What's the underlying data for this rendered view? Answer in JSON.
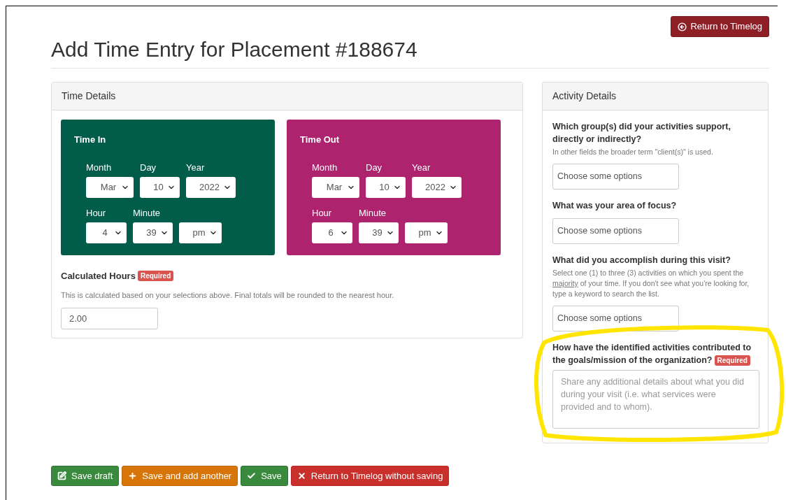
{
  "page": {
    "title": "Add Time Entry for Placement #188674",
    "return_button": "Return to Timelog"
  },
  "time_details": {
    "heading": "Time Details",
    "blocks": [
      {
        "title": "Time In",
        "color": "#025c4a",
        "date_fields": [
          {
            "label": "Month",
            "value": "Mar"
          },
          {
            "label": "Day",
            "value": "10"
          },
          {
            "label": "Year",
            "value": "2022"
          }
        ],
        "time_fields": [
          {
            "label": "Hour",
            "value": "4"
          },
          {
            "label": "Minute",
            "value": "39"
          },
          {
            "value": "pm"
          }
        ]
      },
      {
        "title": "Time Out",
        "color": "#ad236e",
        "date_fields": [
          {
            "label": "Month",
            "value": "Mar"
          },
          {
            "label": "Day",
            "value": "10"
          },
          {
            "label": "Year",
            "value": "2022"
          }
        ],
        "time_fields": [
          {
            "label": "Hour",
            "value": "6"
          },
          {
            "label": "Minute",
            "value": "39"
          },
          {
            "value": "pm"
          }
        ]
      }
    ],
    "calculated": {
      "label": "Calculated Hours",
      "badge": "Required",
      "help": "This is calculated based on your selections above. Final totals will be rounded to the nearest hour.",
      "value": "2.00"
    }
  },
  "activity_details": {
    "heading": "Activity Details",
    "questions": [
      {
        "kind": "select",
        "label": "Which group(s) did your activities support, directly or indirectly?",
        "help": [
          {
            "kind": "text",
            "text": "In other fields the broader term \"client(s)\" is used."
          }
        ],
        "placeholder": "Choose some options"
      },
      {
        "kind": "select",
        "label": "What was your area of focus?",
        "placeholder": "Choose some options"
      },
      {
        "kind": "select",
        "label": "What did you accomplish during this visit?",
        "help": [
          {
            "kind": "text",
            "text": "Select one (1) to three (3) activities on which you spent the "
          },
          {
            "kind": "link",
            "text": "majority"
          },
          {
            "kind": "text",
            "text": " of your time. If you don't see what you're looking for, type a keyword to search the list."
          }
        ],
        "placeholder": "Choose some options"
      },
      {
        "kind": "textarea",
        "label": "How have the identified activities contributed to the goals/mission of the organization?",
        "badge": "Required",
        "placeholder": "Share any additional details about what you did during your visit (i.e. what services were provided and to whom)."
      }
    ]
  },
  "actions": [
    {
      "kind": "draft",
      "label": "Save draft"
    },
    {
      "kind": "add",
      "label": "Save and add another"
    },
    {
      "kind": "save",
      "label": "Save"
    },
    {
      "kind": "cancel",
      "label": "Return to Timelog without saving"
    }
  ]
}
